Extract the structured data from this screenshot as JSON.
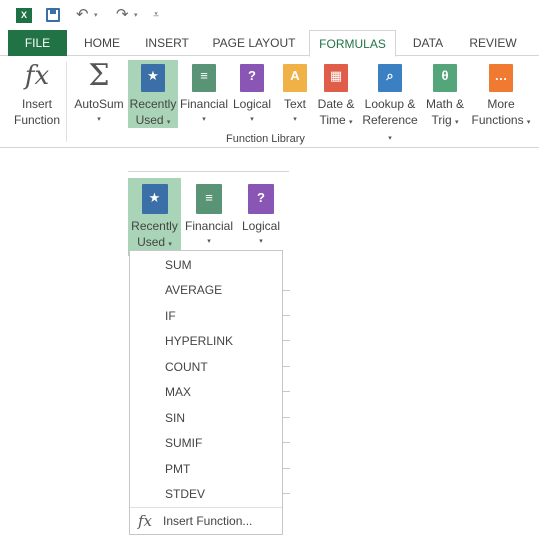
{
  "quick_access": {
    "app_logo_text": "X",
    "icons": [
      "excel-logo-icon",
      "save-icon",
      "undo-icon",
      "redo-icon",
      "customize-icon"
    ]
  },
  "tabs": [
    {
      "label": "FILE"
    },
    {
      "label": "HOME"
    },
    {
      "label": "INSERT"
    },
    {
      "label": "PAGE LAYOUT"
    },
    {
      "label": "FORMULAS",
      "active": true
    },
    {
      "label": "DATA"
    },
    {
      "label": "REVIEW"
    }
  ],
  "ribbon": {
    "insert_function": {
      "line1": "Insert",
      "line2": "Function",
      "icon": "fx"
    },
    "autosum": {
      "line1": "AutoSum",
      "icon": "Σ"
    },
    "recently_used": {
      "line1": "Recently",
      "line2": "Used",
      "icon": "★"
    },
    "financial": {
      "line1": "Financial",
      "icon": "financial-book-icon"
    },
    "logical": {
      "line1": "Logical",
      "icon": "?"
    },
    "text": {
      "line1": "Text",
      "icon": "A"
    },
    "date_time": {
      "line1": "Date &",
      "line2": "Time",
      "icon": "calendar-icon"
    },
    "lookup": {
      "line1": "Lookup &",
      "line2": "Reference",
      "icon": "magnifier-icon"
    },
    "math": {
      "line1": "Math &",
      "line2": "Trig",
      "icon": "θ"
    },
    "more": {
      "line1": "More",
      "line2": "Functions",
      "icon": "…"
    },
    "group_label": "Function Library"
  },
  "dropdown": {
    "recently_used": {
      "line1": "Recently",
      "line2": "Used"
    },
    "financial": {
      "line1": "Financial"
    },
    "logical": {
      "line1": "Logical"
    },
    "items": [
      "SUM",
      "AVERAGE",
      "IF",
      "HYPERLINK",
      "COUNT",
      "MAX",
      "SIN",
      "SUMIF",
      "PMT",
      "STDEV"
    ],
    "insert_function": {
      "icon": "fx",
      "label": "Insert Function..."
    }
  },
  "colors": {
    "accent_green": "#217346",
    "highlight": "#a9d4b7",
    "recent_book": "#3a6fa8",
    "financial_book": "#5a9476",
    "logical_book": "#8a56b5",
    "text_book": "#f0b247",
    "date_book": "#e05d4a",
    "lookup_book": "#3a80c2",
    "math_book": "#55a57b",
    "more_book": "#f07a31"
  }
}
